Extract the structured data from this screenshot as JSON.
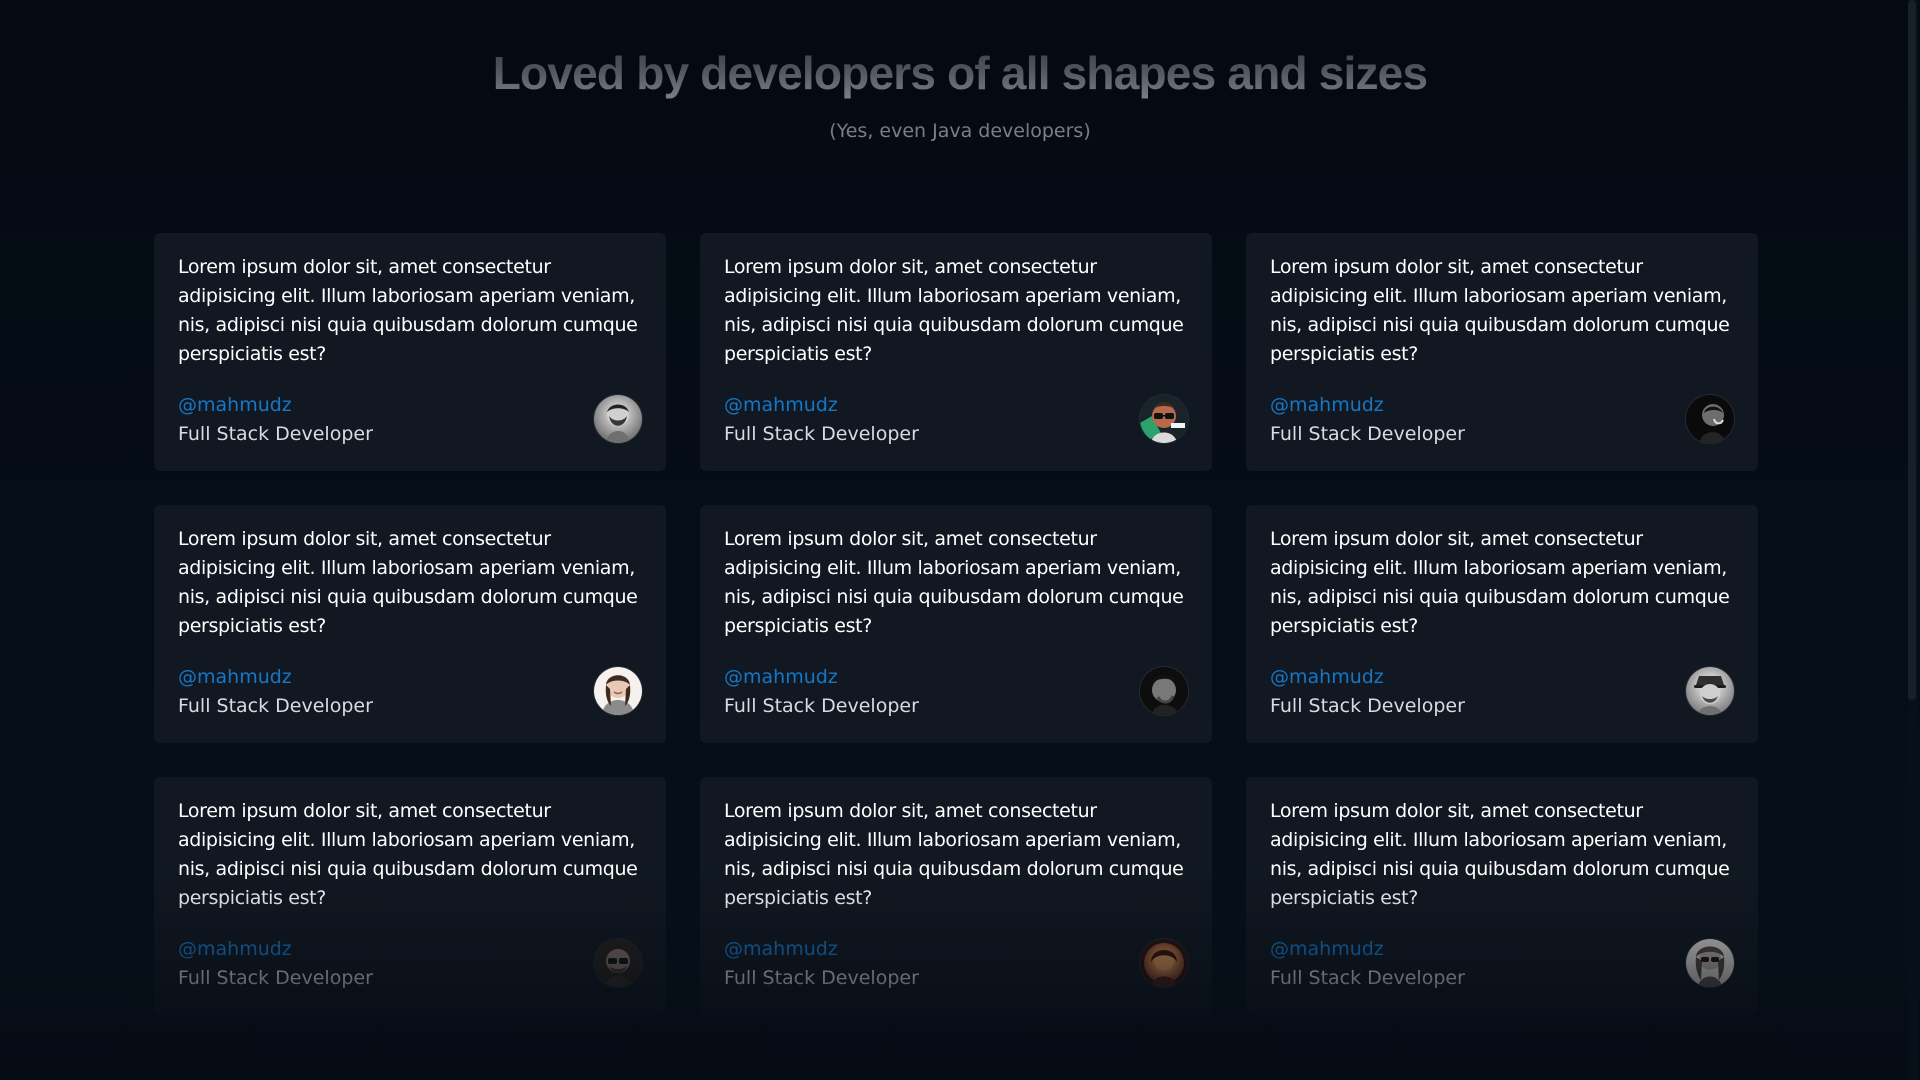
{
  "header": {
    "title": "Loved by developers of all shapes and sizes",
    "subtitle": "(Yes, even Java developers)"
  },
  "testimonials": [
    {
      "quote": "Lorem ipsum dolor sit, amet consectetur adipisicing elit. Illum laboriosam aperiam veniam, nis, adipisci nisi quia quibusdam dolorum cumque perspiciatis est?",
      "handle": "@mahmudz",
      "role": "Full Stack Developer",
      "avatar": "man-with-beard-photo"
    },
    {
      "quote": "Lorem ipsum dolor sit, amet consectetur adipisicing elit. Illum laboriosam aperiam veniam, nis, adipisci nisi quia quibusdam dolorum cumque perspiciatis est?",
      "handle": "@mahmudz",
      "role": "Full Stack Developer",
      "avatar": "man-with-glasses-photo"
    },
    {
      "quote": "Lorem ipsum dolor sit, amet consectetur adipisicing elit. Illum laboriosam aperiam veniam, nis, adipisci nisi quia quibusdam dolorum cumque perspiciatis est?",
      "handle": "@mahmudz",
      "role": "Full Stack Developer",
      "avatar": "man-dark-portrait-photo"
    },
    {
      "quote": "Lorem ipsum dolor sit, amet consectetur adipisicing elit. Illum laboriosam aperiam veniam, nis, adipisci nisi quia quibusdam dolorum cumque perspiciatis est?",
      "handle": "@mahmudz",
      "role": "Full Stack Developer",
      "avatar": "woman-smiling-photo"
    },
    {
      "quote": "Lorem ipsum dolor sit, amet consectetur adipisicing elit. Illum laboriosam aperiam veniam, nis, adipisci nisi quia quibusdam dolorum cumque perspiciatis est?",
      "handle": "@mahmudz",
      "role": "Full Stack Developer",
      "avatar": "man-dark-hair-photo"
    },
    {
      "quote": "Lorem ipsum dolor sit, amet consectetur adipisicing elit. Illum laboriosam aperiam veniam, nis, adipisci nisi quia quibusdam dolorum cumque perspiciatis est?",
      "handle": "@mahmudz",
      "role": "Full Stack Developer",
      "avatar": "man-with-hat-photo"
    },
    {
      "quote": "Lorem ipsum dolor sit, amet consectetur adipisicing elit. Illum laboriosam aperiam veniam, nis, adipisci nisi quia quibusdam dolorum cumque perspiciatis est?",
      "handle": "@mahmudz",
      "role": "Full Stack Developer",
      "avatar": "man-with-sunglasses-photo"
    },
    {
      "quote": "Lorem ipsum dolor sit, amet consectetur adipisicing elit. Illum laboriosam aperiam veniam, nis, adipisci nisi quia quibusdam dolorum cumque perspiciatis est?",
      "handle": "@mahmudz",
      "role": "Full Stack Developer",
      "avatar": "woman-orange-light-photo"
    },
    {
      "quote": "Lorem ipsum dolor sit, amet consectetur adipisicing elit. Illum laboriosam aperiam veniam, nis, adipisci nisi quia quibusdam dolorum cumque perspiciatis est?",
      "handle": "@mahmudz",
      "role": "Full Stack Developer",
      "avatar": "woman-with-sunglasses-photo"
    }
  ],
  "colors": {
    "background": "#050c15",
    "card": "#111821",
    "handle": "#1677c6",
    "role": "#d8dce2",
    "text": "#ffffff"
  }
}
